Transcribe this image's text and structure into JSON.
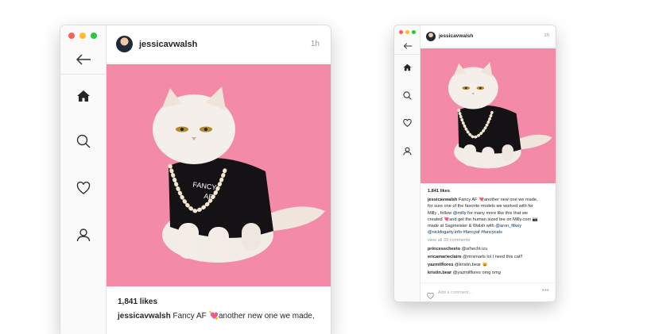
{
  "colors": {
    "close": "#ff5f57",
    "minimize": "#febc2e",
    "zoom": "#28c840",
    "photo_bg": "#f38ba8",
    "link": "#003569"
  },
  "large_window": {
    "post": {
      "username": "jessicavwalsh",
      "time": "1h",
      "likes": "1,841 likes",
      "caption_user": "jessicavwalsh",
      "caption_text": "Fancy AF 💘another new one we made,"
    },
    "nav_icons": [
      "back-arrow-icon",
      "home-icon",
      "search-icon",
      "heart-icon",
      "profile-icon"
    ]
  },
  "small_window": {
    "post": {
      "username": "jessicavwalsh",
      "time": "1h",
      "likes": "1,841 likes",
      "caption_user": "jessicavwalsh",
      "caption_lines": [
        "Fancy AF 💘another new one we made,",
        "for sure one of the favorite models we worked with for",
        "Milly , follow",
        "for many more like this that we",
        "created 💘and get the human sized tee on Milly.com 📷",
        "made at Sagmeister & Walsh with"
      ],
      "mentions": {
        "milly": "@milly",
        "aron": "@aron_filkey"
      },
      "tags_line": "@nickfogarty.info #fancyaf #fancycats",
      "view_all": "view all 39 comments",
      "comments": [
        {
          "user": "princesscheeto",
          "text": "@srhecht izu"
        },
        {
          "user": "ericamarieclaire",
          "text": "@mrsmarls lol I need this cat!!"
        },
        {
          "user": "yazmilflores",
          "text": "@kristin.bear 😺"
        },
        {
          "user": "kristin.bear",
          "text": "@yazmilflores omg omg"
        }
      ],
      "add_comment_placeholder": "Add a comment...",
      "more": "•••"
    }
  },
  "photo": {
    "shirt_text_1": "FANCY",
    "shirt_text_2": "AF"
  }
}
